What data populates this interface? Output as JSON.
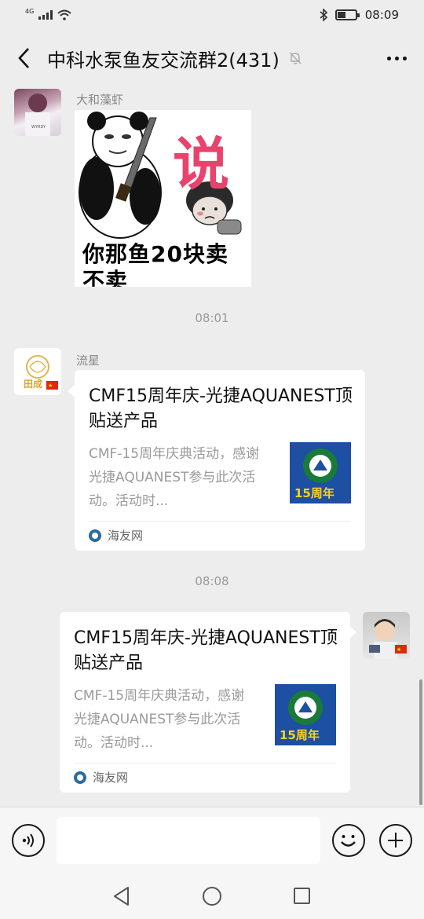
{
  "status_bar": {
    "network": "4G",
    "time": "08:09",
    "battery_level": 0.45
  },
  "header": {
    "title": "中科水泵鱼友交流群2(431)",
    "back_icon": "chevron-left-icon",
    "mute_icon": "bell-off-icon",
    "more_icon": "more-dots-icon"
  },
  "messages": [
    {
      "sender": "大和藻虾",
      "type": "sticker",
      "sticker": {
        "big_char": "说",
        "line1": "你那鱼20块卖",
        "line2": "不卖"
      }
    },
    {
      "type": "time",
      "text": "08:01"
    },
    {
      "sender": "流星",
      "type": "link_card",
      "card": {
        "title": "CMF15周年庆-光捷AQUANEST顶贴送产品",
        "desc": "CMF-15周年庆典活动，感谢光捷AQUANEST参与此次活动。活动时...",
        "thumb_text": "15周年",
        "source": "海友网"
      }
    },
    {
      "type": "time",
      "text": "08:08"
    },
    {
      "sender": "",
      "type": "link_card",
      "self": true,
      "card": {
        "title": "CMF15周年庆-光捷AQUANEST顶贴送产品",
        "desc": "CMF-15周年庆典活动，感谢光捷AQUANEST参与此次活动。活动时...",
        "thumb_text": "15周年",
        "source": "海友网"
      }
    }
  ],
  "input_bar": {
    "voice_icon": "voice-icon",
    "emoji_icon": "emoji-icon",
    "plus_icon": "plus-icon",
    "input_value": ""
  },
  "nav_bar": {
    "back_icon": "nav-back-icon",
    "home_icon": "nav-home-icon",
    "recent_icon": "nav-recent-icon"
  },
  "colors": {
    "background": "#ededed",
    "card": "#ffffff",
    "sticker_accent": "#e8436c",
    "thumb_blue": "#1d4fa2"
  }
}
